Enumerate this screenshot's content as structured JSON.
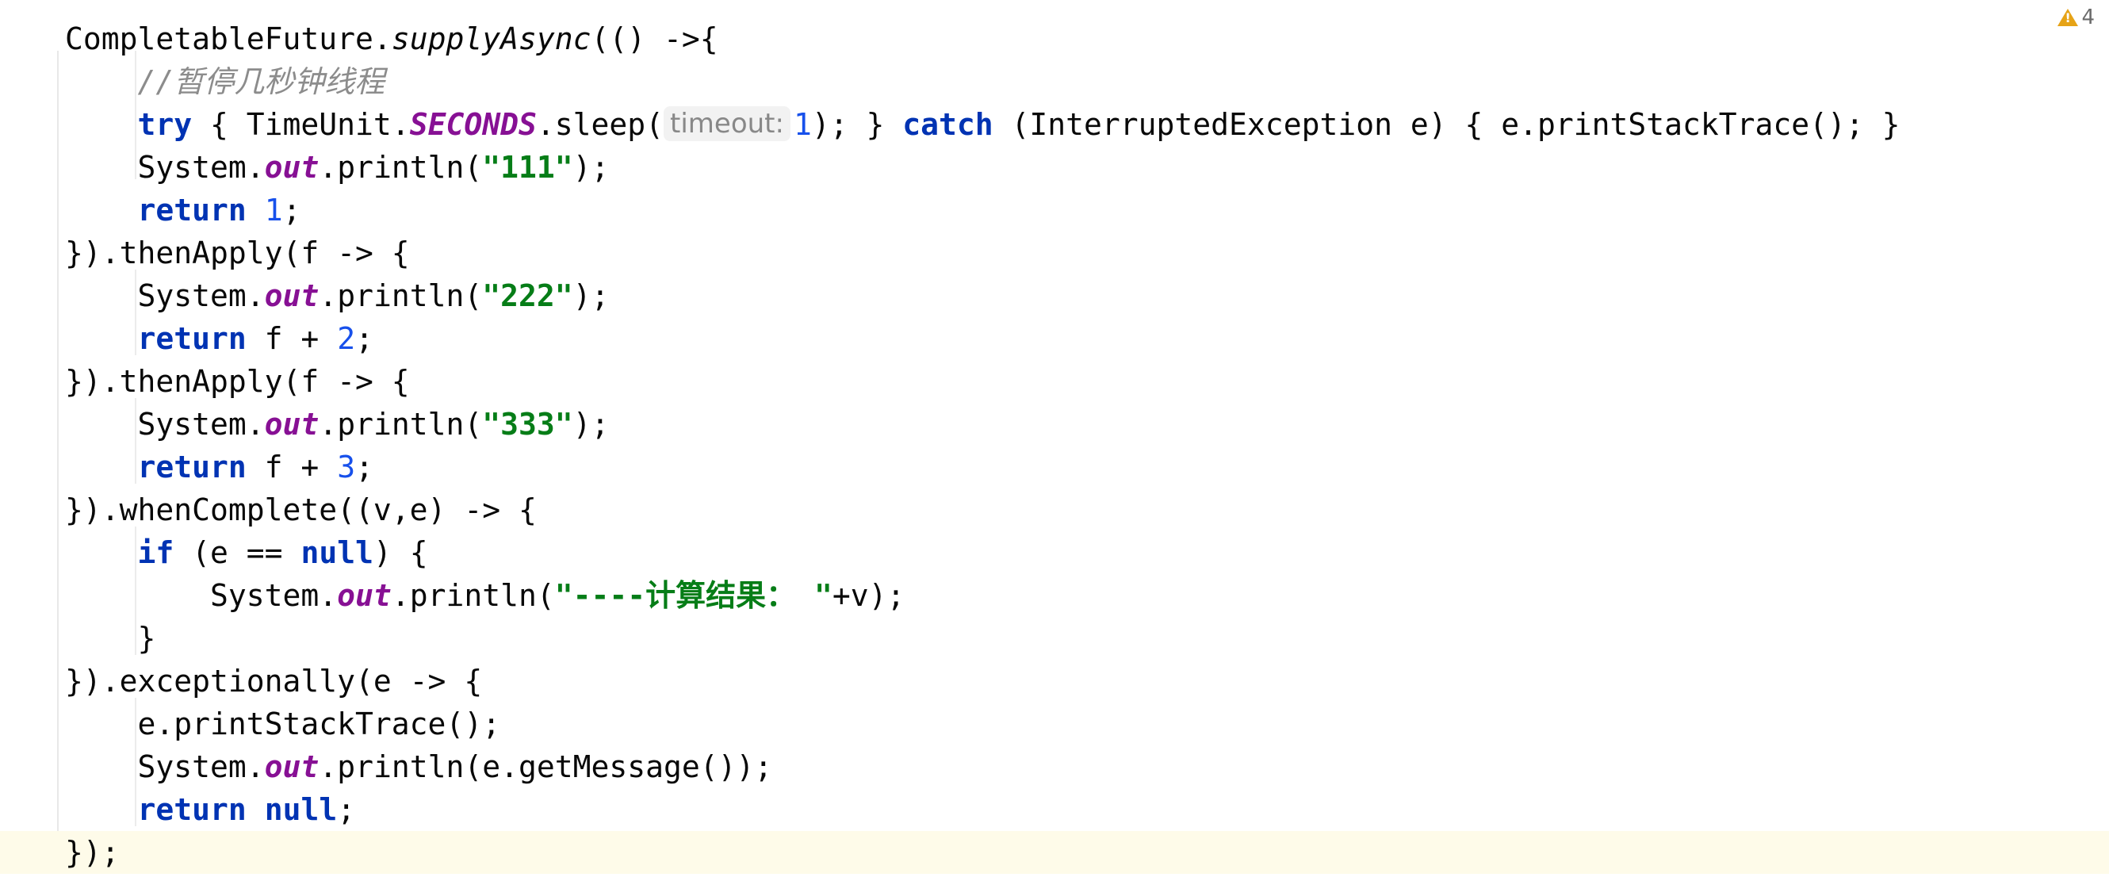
{
  "editor": {
    "warning_count": "4",
    "lines": [
      [
        "CompletableFuture.",
        "supplyAsync",
        "(() ->{"
      ],
      [
        "    ",
        "//暂停几秒钟线程"
      ],
      [
        "    ",
        "try",
        " { TimeUnit.",
        "SECONDS",
        ".sleep(",
        "timeout:",
        " ",
        "1",
        "); } ",
        "catch",
        " (InterruptedException e) { e.printStackTrace(); }"
      ],
      [
        "    System.",
        "out",
        ".println(",
        "\"111\"",
        ");"
      ],
      [
        "    ",
        "return",
        " ",
        "1",
        ";"
      ],
      [
        "}).thenApply(f -> {"
      ],
      [
        "    System.",
        "out",
        ".println(",
        "\"222\"",
        ");"
      ],
      [
        "    ",
        "return",
        " f + ",
        "2",
        ";"
      ],
      [
        "}).thenApply(f -> {"
      ],
      [
        "    System.",
        "out",
        ".println(",
        "\"333\"",
        ");"
      ],
      [
        "    ",
        "return",
        " f + ",
        "3",
        ";"
      ],
      [
        "}).whenComplete((v,e) -> {"
      ],
      [
        "    ",
        "if",
        " (e == ",
        "null",
        ") {"
      ],
      [
        "        System.",
        "out",
        ".println(",
        "\"----计算结果： \"",
        "+v);"
      ],
      [
        "    }"
      ],
      [
        "}).exceptionally(e -> {"
      ],
      [
        "    e.printStackTrace();"
      ],
      [
        "    System.",
        "out",
        ".println(e.getMessage());"
      ],
      [
        "    ",
        "return",
        " ",
        "null",
        ";"
      ],
      [
        "});"
      ]
    ]
  },
  "colors": {
    "keyword": "#0033b3",
    "string": "#067d17",
    "number": "#1750eb",
    "static_field": "#871094",
    "comment": "#8c8c8c",
    "warning": "#e6a317",
    "current_line": "#fefbe9"
  }
}
